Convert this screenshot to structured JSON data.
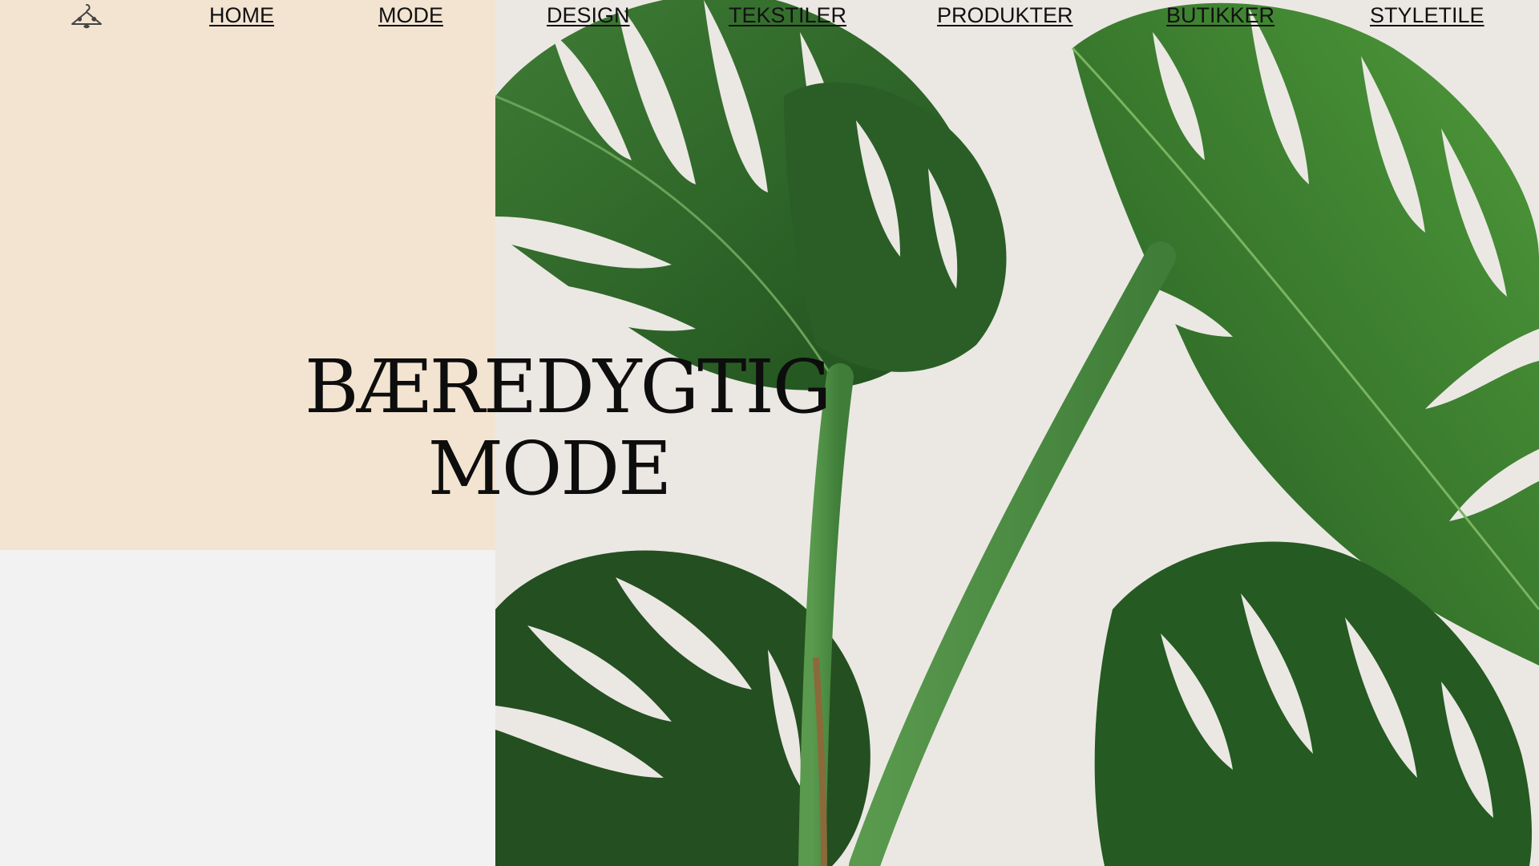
{
  "nav": {
    "logo_icon": "hanger-icon",
    "items": [
      {
        "label": "HOME"
      },
      {
        "label": "MODE"
      },
      {
        "label": "DESIGN"
      },
      {
        "label": "TEKSTILER"
      },
      {
        "label": "PRODUKTER"
      },
      {
        "label": "BUTIKKER"
      },
      {
        "label": "STYLETILE"
      }
    ]
  },
  "hero": {
    "title_line1": "BÆREDYGTIG",
    "title_line2": "MODE",
    "image_subject": "monstera-leaves-photo"
  },
  "colors": {
    "beige": "#f3e4d2",
    "background": "#f2f2f2",
    "photo_background": "#ebe8e4",
    "leaf_green": "#2f6b2c",
    "text": "#0d0d0d"
  }
}
